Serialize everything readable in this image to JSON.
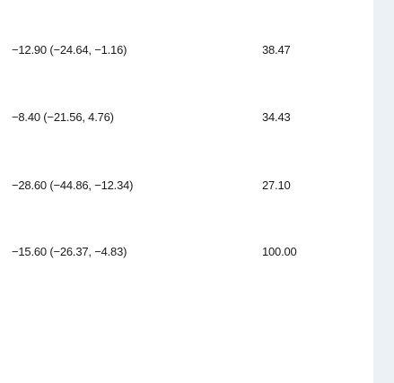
{
  "table": {
    "rows": [
      {
        "effect": "−12.90 (−24.64, −1.16)",
        "weight": "38.47"
      },
      {
        "effect": "−8.40 (−21.56, 4.76)",
        "weight": "34.43"
      },
      {
        "effect": "−28.60 (−44.86, −12.34)",
        "weight": "27.10"
      },
      {
        "effect": "−15.60 (−26.37, −4.83)",
        "weight": "100.00"
      }
    ]
  }
}
